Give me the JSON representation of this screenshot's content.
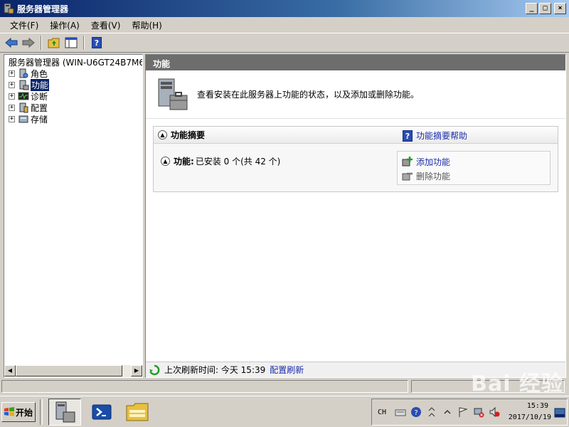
{
  "window": {
    "title": "服务器管理器",
    "icon": "server-manager-icon",
    "buttons": {
      "minimize": "_",
      "maximize": "□",
      "close": "×"
    }
  },
  "menu": [
    {
      "label": "文件(F)"
    },
    {
      "label": "操作(A)"
    },
    {
      "label": "查看(V)"
    },
    {
      "label": "帮助(H)"
    }
  ],
  "toolbar": {
    "icons": [
      "back-arrow-icon",
      "forward-arrow-icon",
      "folder-up-icon",
      "show-hide-tree-icon",
      "help-icon"
    ],
    "help_glyph": "?"
  },
  "tree": {
    "root": "服务器管理器 (WIN-U6GT24B7M6",
    "items": [
      {
        "label": "角色",
        "icon": "roles-icon",
        "expander": "+"
      },
      {
        "label": "功能",
        "icon": "features-icon",
        "expander": "+",
        "selected": true
      },
      {
        "label": "诊断",
        "icon": "diagnostics-icon",
        "expander": "+"
      },
      {
        "label": "配置",
        "icon": "configuration-icon",
        "expander": "+"
      },
      {
        "label": "存储",
        "icon": "storage-icon",
        "expander": "+"
      }
    ]
  },
  "content": {
    "header": "功能",
    "intro": "查看安装在此服务器上功能的状态，以及添加或删除功能。",
    "summary": {
      "title": "功能摘要",
      "help_link": "功能摘要帮助",
      "installed_label": "功能:",
      "installed_value": "已安装 0 个(共 42 个)",
      "actions": [
        {
          "label": "添加功能",
          "enabled": true
        },
        {
          "label": "删除功能",
          "enabled": false
        }
      ]
    },
    "refresh": {
      "text": "上次刷新时间: 今天 15:39",
      "link": "配置刷新"
    }
  },
  "taskbar": {
    "start": "开始",
    "tray_lang": "CH",
    "clock_time": "15:39",
    "clock_date": "2017/10/19"
  },
  "watermark": "Bai 经验",
  "colors": {
    "title_gradient_start": "#0a246a",
    "header_gray": "#6d6d6d",
    "link_blue": "#1a2ca8",
    "selected_bg": "#0a246a"
  }
}
